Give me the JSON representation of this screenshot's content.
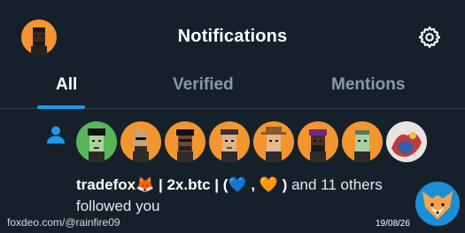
{
  "header": {
    "title": "Notifications",
    "profile_icon": "profile-avatar-icon",
    "settings_icon": "gear-icon"
  },
  "tabs": [
    {
      "label": "All",
      "active": true
    },
    {
      "label": "Verified",
      "active": false
    },
    {
      "label": "Mentions",
      "active": false
    }
  ],
  "notification": {
    "type_icon": "person-icon",
    "avatars_count": 8,
    "name": "tradefox🦊",
    "name_rest": " | 2x.btc | (💙 , 🧡 )",
    "others": " and 11 others",
    "action": "followed you"
  },
  "watermark": {
    "source": "foxdeo.com/@rainfire09",
    "date": "19/08/26"
  },
  "colors": {
    "background": "#15202b",
    "accent": "#1d9bf0",
    "inactive_tab": "#8b98a5",
    "avatar_orange": "#f4962f"
  }
}
